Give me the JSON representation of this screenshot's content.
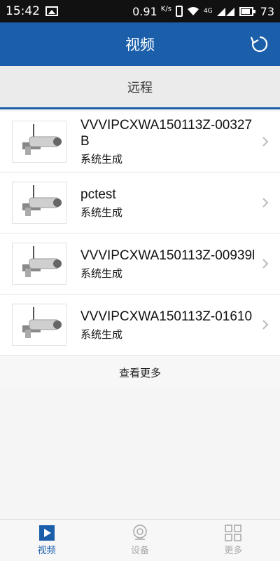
{
  "status_bar": {
    "time": "15:42",
    "data_speed": "0.91",
    "data_unit": "K/s",
    "network": "4G",
    "battery": "73",
    "icons": [
      "image-icon",
      "vibrate-icon",
      "wifi-icon",
      "signal-icon",
      "battery-icon"
    ]
  },
  "header": {
    "title": "视频",
    "refresh_icon": "refresh-icon"
  },
  "segment": {
    "label": "远程"
  },
  "devices": [
    {
      "name": "VVVIPCXWA150113Z-00327B",
      "subtitle": "系统生成"
    },
    {
      "name": "pctest",
      "subtitle": "系统生成"
    },
    {
      "name": "VVVIPCXWA150113Z-00939l",
      "subtitle": "系统生成"
    },
    {
      "name": "VVVIPCXWA150113Z-01610",
      "subtitle": "系统生成"
    }
  ],
  "load_more": "查看更多",
  "tabs": [
    {
      "label": "视频",
      "icon": "play-icon",
      "active": true
    },
    {
      "label": "设备",
      "icon": "camera-icon",
      "active": false
    },
    {
      "label": "更多",
      "icon": "grid-icon",
      "active": false
    }
  ],
  "colors": {
    "accent": "#1b5fab",
    "inactive": "#aaaaaa"
  }
}
